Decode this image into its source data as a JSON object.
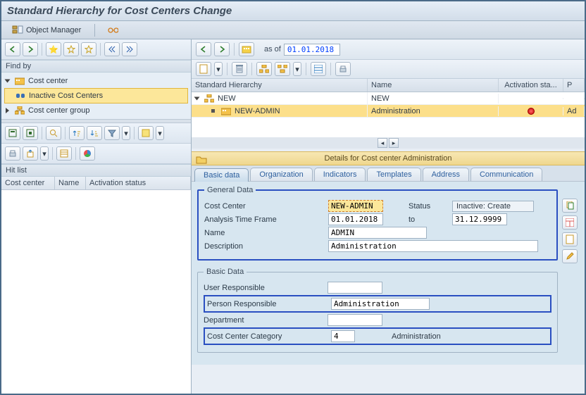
{
  "window": {
    "title": "Standard Hierarchy for Cost Centers Change"
  },
  "app_toolbar": {
    "object_manager": "Object Manager"
  },
  "find_by": {
    "label": "Find by",
    "cost_center": "Cost center",
    "inactive": "Inactive Cost Centers",
    "cc_group": "Cost center group"
  },
  "hit": {
    "title": "Hit list",
    "col_cc": "Cost center",
    "col_name": "Name",
    "col_status": "Activation status"
  },
  "right": {
    "as_of_label": "as of",
    "as_of_value": "01.01.2018"
  },
  "grid": {
    "col_hierarchy": "Standard Hierarchy",
    "col_name": "Name",
    "col_status": "Activation sta...",
    "col_p": "P",
    "row0_code": "NEW",
    "row0_name": "NEW",
    "row1_code": "NEW-ADMIN",
    "row1_name": "Administration",
    "row1_p": "Ad"
  },
  "details_bar": {
    "text": "Details for Cost center Administration"
  },
  "tabs": {
    "basic": "Basic data",
    "org": "Organization",
    "ind": "Indicators",
    "tmpl": "Templates",
    "addr": "Address",
    "comm": "Communication"
  },
  "general": {
    "legend": "General Data",
    "lbl_cc": "Cost Center",
    "val_cc": "NEW-ADMIN",
    "lbl_status": "Status",
    "val_status": "Inactive: Create",
    "lbl_tf": "Analysis Time Frame",
    "val_from": "01.01.2018",
    "lbl_to": "to",
    "val_to": "31.12.9999",
    "lbl_name": "Name",
    "val_name": "ADMIN",
    "lbl_desc": "Description",
    "val_desc": "Administration"
  },
  "basic": {
    "legend": "Basic Data",
    "lbl_user": "User Responsible",
    "val_user": "",
    "lbl_person": "Person Responsible",
    "val_person": "Administration",
    "lbl_dept": "Department",
    "val_dept": "",
    "lbl_cat": "Cost Center Category",
    "val_cat_code": "4",
    "val_cat_text": "Administration"
  }
}
